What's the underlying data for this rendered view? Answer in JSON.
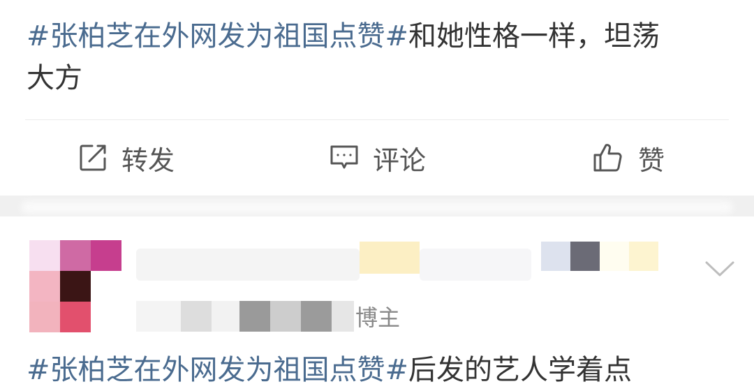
{
  "post1": {
    "hashtag": "#张柏芝在外网发为祖国点赞#",
    "text_line1": "和她性格一样，坦荡",
    "text_line2": "大方"
  },
  "actions": {
    "repost_label": "转发",
    "comment_label": "评论",
    "like_label": "赞"
  },
  "post2": {
    "role_badge": "博主",
    "hashtag": "#张柏芝在外网发为祖国点赞#",
    "text": "后发的艺人学着点"
  },
  "colors": {
    "hashtag": "#4a6b8f",
    "text": "#333333",
    "action_text": "#555555",
    "separator": "#f0f0f0"
  },
  "icons": [
    "repost-icon",
    "comment-icon",
    "like-icon",
    "chevron-down-icon"
  ]
}
